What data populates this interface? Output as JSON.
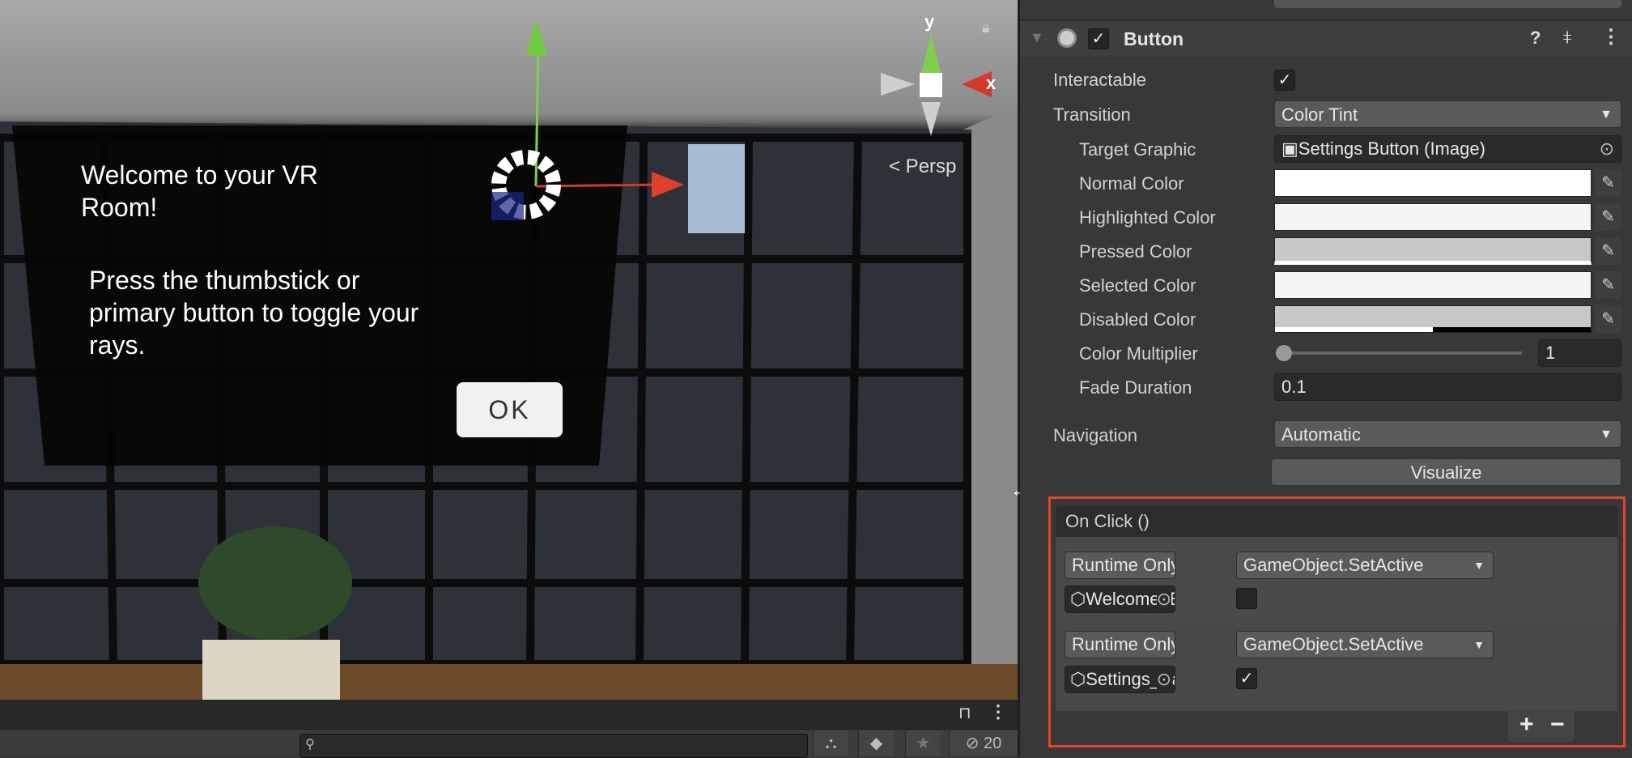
{
  "scene": {
    "welcome_title": "Welcome to your VR Room!",
    "welcome_body": "Press the thumbstick or primary button to toggle your rays.",
    "ok_label": "OK",
    "projection_label": "< Persp",
    "gizmo_axes": {
      "y": "y",
      "x": "x"
    }
  },
  "bottom_panel": {
    "search_placeholder": "",
    "hidden_count": "20"
  },
  "inspector": {
    "component": {
      "title": "Button",
      "enabled": true
    },
    "properties": {
      "interactable_label": "Interactable",
      "interactable": true,
      "transition_label": "Transition",
      "transition": "Color Tint",
      "target_graphic_label": "Target Graphic",
      "target_graphic": "Settings Button (Image)",
      "normal_color_label": "Normal Color",
      "normal_color": "#ffffff",
      "highlighted_color_label": "Highlighted Color",
      "highlighted_color": "#f5f5f5",
      "pressed_color_label": "Pressed Color",
      "pressed_color": "#c8c8c8",
      "selected_color_label": "Selected Color",
      "selected_color": "#f5f5f5",
      "disabled_color_label": "Disabled Color",
      "disabled_color": "#c8c8c8",
      "disabled_alpha": 0.5,
      "color_multiplier_label": "Color Multiplier",
      "color_multiplier": "1",
      "color_multiplier_fraction": 0,
      "fade_duration_label": "Fade Duration",
      "fade_duration": "0.1",
      "navigation_label": "Navigation",
      "navigation": "Automatic",
      "visualize_label": "Visualize"
    },
    "on_click": {
      "title": "On Click ()",
      "entries": [
        {
          "mode": "Runtime Only",
          "function": "GameObject.SetActive",
          "target": "Welcome_E",
          "value": false
        },
        {
          "mode": "Runtime Only",
          "function": "GameObject.SetActive",
          "target": "Settings_Ba",
          "value": true
        }
      ],
      "add_label": "+",
      "remove_label": "−"
    },
    "highlight_color": "#e8432a"
  }
}
